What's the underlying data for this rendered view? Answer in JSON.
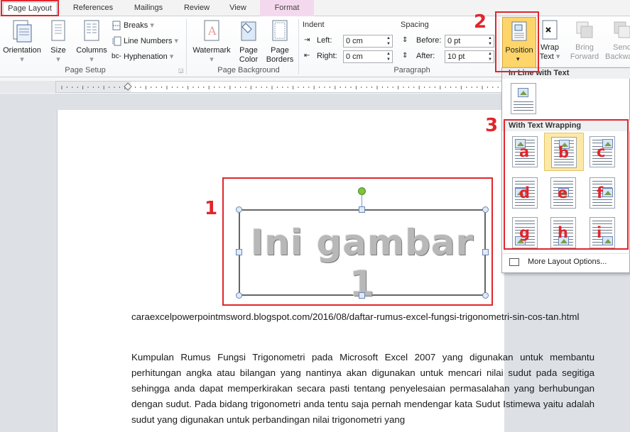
{
  "tabs": [
    {
      "label": "Page Layout"
    },
    {
      "label": "References"
    },
    {
      "label": "Mailings"
    },
    {
      "label": "Review"
    },
    {
      "label": "View"
    },
    {
      "label": "Format"
    }
  ],
  "ribbon": {
    "page_setup": {
      "orientation": "Orientation",
      "size": "Size",
      "columns": "Columns",
      "breaks": "Breaks",
      "line_numbers": "Line Numbers",
      "hyphenation": "Hyphenation",
      "group_label": "Page Setup"
    },
    "page_background": {
      "watermark": "Watermark",
      "page_color": "Page Color",
      "page_borders": "Page Borders",
      "group_label": "Page Background"
    },
    "paragraph": {
      "indent_header": "Indent",
      "left_label": "Left:",
      "left_value": "0 cm",
      "right_label": "Right:",
      "right_value": "0 cm",
      "spacing_header": "Spacing",
      "before_label": "Before:",
      "before_value": "0 pt",
      "after_label": "After:",
      "after_value": "10 pt",
      "group_label": "Paragraph"
    },
    "arrange": {
      "position": "Position",
      "wrap_text": "Wrap Text",
      "bring_forward": "Bring Forward",
      "send_backward": "Send Backward"
    }
  },
  "annotations": {
    "one": "1",
    "two": "2",
    "three": "3"
  },
  "picture_text": "Ini gambar 1",
  "document": {
    "url_line": "caraexcelpowerpointmsword.blogspot.com/2016/08/daftar-rumus-excel-fungsi-trigonometri-sin-cos-tan.html",
    "paragraph": "Kumpulan Rumus Fungsi Trigonometri pada Microsoft Excel 2007 yang digunakan untuk membantu perhitungan angka atau bilangan yang nantinya akan digunakan untuk mencari nilai sudut pada segitiga sehingga anda dapat memperkirakan secara pasti tentang penyelesaian permasalahan yang berhubungan dengan sudut. Pada bidang trigonometri anda tentu saja pernah mendengar kata Sudut Istimewa yaitu adalah sudut  yang digunakan untuk perbandingan nilai trigonometri yang"
  },
  "position_dropdown": {
    "inline_header": "In Line with Text",
    "wrapping_header": "With Text Wrapping",
    "letters": [
      "a",
      "b",
      "c",
      "d",
      "e",
      "f",
      "g",
      "h",
      "i"
    ],
    "more_layout": "More Layout Options..."
  },
  "colors": {
    "annotation_red": "#e0262c",
    "selected_highlight": "#fde9a7",
    "format_tab": "#f4d9ee"
  }
}
